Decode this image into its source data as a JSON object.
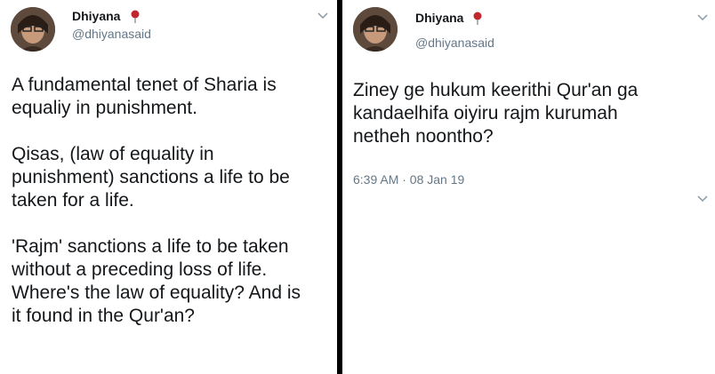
{
  "tweets": [
    {
      "name": "Dhiyana",
      "handle": "@dhiyanasaid",
      "text": "A fundamental tenet of Sharia is\nequaliy in punishment.\n\nQisas, (law of equality in\npunishment) sanctions a life to be\ntaken for a life.\n\n'Rajm' sanctions a life to be taken\nwithout a preceding loss of life.\nWhere's the law of equality? And is\nit found in the Qur'an?",
      "icons": [
        "avatar",
        "pin-icon",
        "chevron-down-icon"
      ]
    },
    {
      "name": "Dhiyana",
      "handle": "@dhiyanasaid",
      "text": "Ziney ge hukum keerithi Qur'an ga\nkandaelhifa oiyiru rajm kurumah\nnetheh noontho?",
      "timestamp": "6:39 AM · 08 Jan 19",
      "icons": [
        "avatar",
        "pin-icon",
        "chevron-down-icon"
      ]
    }
  ],
  "colors": {
    "name": "#14171a",
    "secondary": "#657786",
    "pin": "#c0282d",
    "divider": "#000000"
  }
}
